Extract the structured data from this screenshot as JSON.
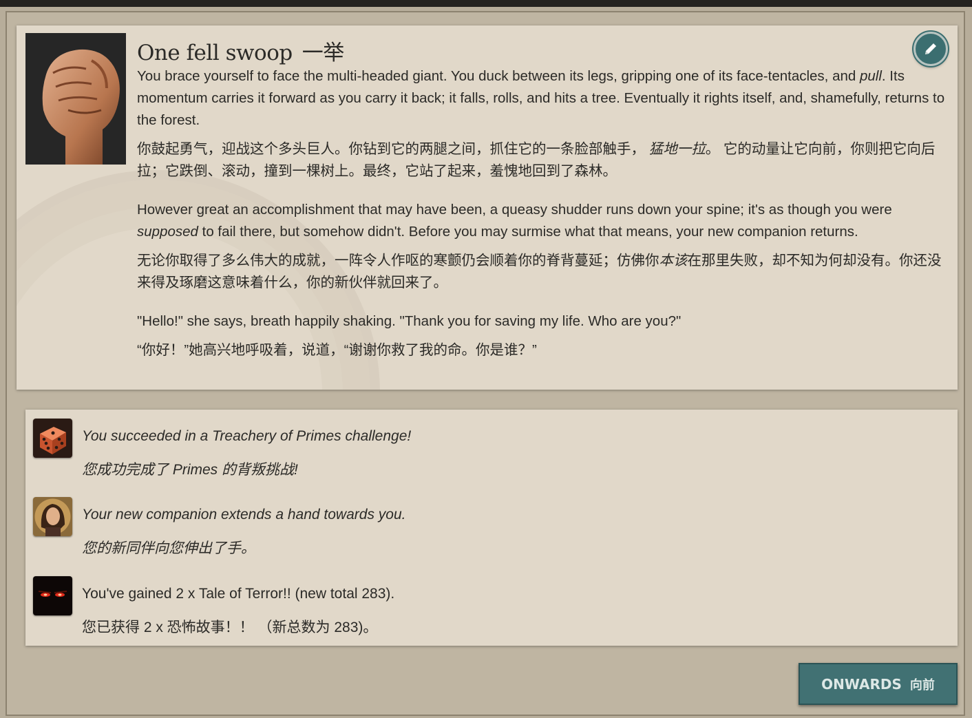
{
  "storylet": {
    "title": "One fell swoop",
    "title_zh": "一举",
    "edit_icon": "pencil-icon",
    "portrait_icon": "fist-icon",
    "paragraphs": [
      {
        "en_a": "You brace yourself to face the multi-headed giant. You duck between its legs, gripping one of its face-tentacles, and ",
        "en_em": "pull",
        "en_b": ". Its momentum carries it forward as you carry it back; it falls, rolls, and hits a tree. Eventually it rights itself, and, shamefully, returns to the forest.",
        "zh_a": "你鼓起勇气，迎战这个多头巨人。你钻到它的两腿之间，抓住它的一条脸部触手， ",
        "zh_em": "猛地一拉",
        "zh_b": "。 它的动量让它向前，你则把它向后拉；它跌倒、滚动，撞到一棵树上。最终，它站了起来，羞愧地回到了森林。"
      },
      {
        "en_a": "However great an accomplishment that may have been, a queasy shudder runs down your spine; it's as though you were ",
        "en_em": "supposed",
        "en_b": " to fail there, but somehow didn't. Before you may surmise what that means, your new companion returns.",
        "zh_a": "无论你取得了多么伟大的成就，一阵令人作呕的寒颤仍会顺着你的脊背蔓延；仿佛你",
        "zh_em": "本该",
        "zh_b": "在那里失败，却不知为何却没有。你还没来得及琢磨这意味着什么，你的新伙伴就回来了。"
      },
      {
        "en_a": "\"Hello!\" she says, breath happily shaking. \"Thank you for saving my life. Who are you?\"",
        "zh_a": "“你好！”她高兴地呼吸着，说道，“谢谢你救了我的命。你是谁？”"
      }
    ]
  },
  "outcomes": [
    {
      "icon": "dice-icon",
      "en": "You succeeded in a Treachery of Primes challenge!",
      "zh": "您成功完成了 Primes 的背叛挑战!",
      "italic": true
    },
    {
      "icon": "companion-portrait-icon",
      "en": "Your new companion extends a hand towards you.",
      "zh": "您的新同伴向您伸出了手。",
      "italic": true
    },
    {
      "icon": "red-eyes-icon",
      "en": "You've gained 2 x Tale of Terror!! (new total 283).",
      "zh": "您已获得 2 x 恐怖故事！！ （新总数为 283)。",
      "italic": false
    }
  ],
  "onwards": {
    "label": "ONWARDS",
    "label_zh": "向前"
  },
  "colors": {
    "panel": "#e1d8c9",
    "background": "#b7ad9a",
    "accent": "#417173",
    "text": "#2b2a27"
  }
}
